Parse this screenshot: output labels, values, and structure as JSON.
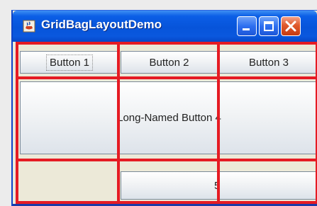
{
  "window": {
    "title": "GridBagLayoutDemo"
  },
  "buttons": {
    "b1": "Button 1",
    "b2": "Button 2",
    "b3": "Button 3",
    "b4": "Long-Named Button 4",
    "b5": "5"
  },
  "colors": {
    "titlebar": "#0754da",
    "grid_overlay": "#e51b23",
    "client_background": "#ece9d8"
  }
}
